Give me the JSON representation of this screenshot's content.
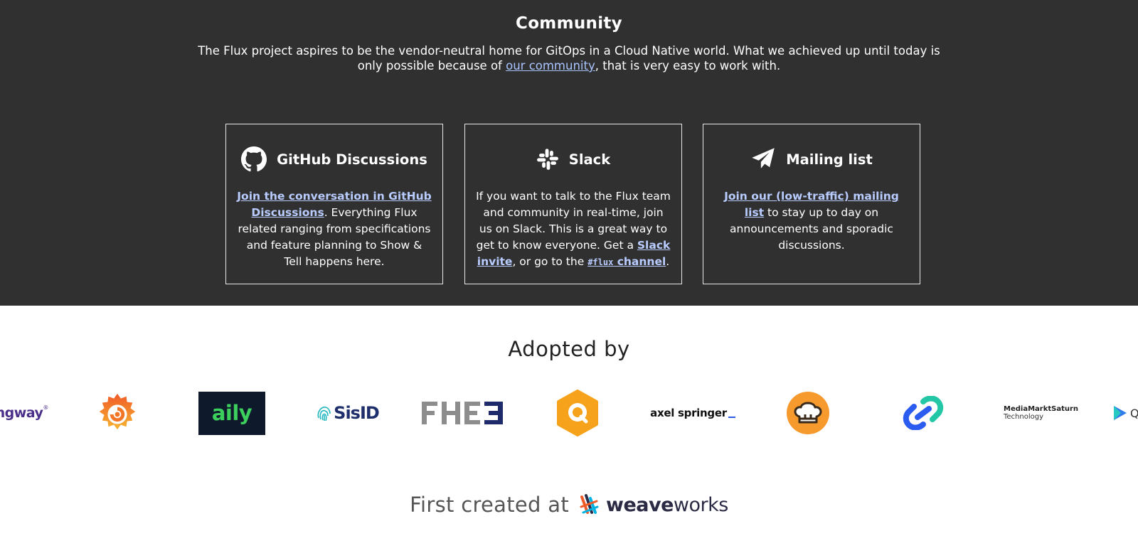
{
  "community": {
    "title": "Community",
    "intro_before": "The Flux project aspires to be the vendor-neutral home for GitOps in a Cloud Native world. What we achieved up until today is only possible because of ",
    "intro_link": "our community",
    "intro_after": ", that is very easy to work with.",
    "cards": [
      {
        "title": "GitHub Discussions",
        "icon": "github-icon",
        "link1": "Join the conversation in GitHub Discussions",
        "text1": ". Everything Flux related ranging from specifications and feature planning to Show & Tell happens here."
      },
      {
        "title": "Slack",
        "icon": "slack-icon",
        "text1": "If you want to talk to the Flux team and community in real-time, join us on Slack. This is a great way to get to know everyone. Get a ",
        "link1": "Slack invite",
        "text2": ", or go to the ",
        "link2_code": "#flux",
        "link2_text": " channel",
        "text3": "."
      },
      {
        "title": "Mailing list",
        "icon": "paper-plane-icon",
        "link1": "Join our (low-traffic) mailing list",
        "text1": " to stay up to day on announcements and sporadic discussions."
      }
    ]
  },
  "adopted": {
    "title": "Adopted by",
    "logos": [
      {
        "name": "gway-logo",
        "text": "ngway"
      },
      {
        "name": "grafana-logo",
        "text": ""
      },
      {
        "name": "aily-logo",
        "text": "aily"
      },
      {
        "name": "sisid-logo",
        "text": "SisID"
      },
      {
        "name": "fhe3-logo",
        "text": "FHE3"
      },
      {
        "name": "orange-hex-logo",
        "text": ""
      },
      {
        "name": "axel-springer-logo",
        "text": "axel springer"
      },
      {
        "name": "chef-logo",
        "text": ""
      },
      {
        "name": "link-logo",
        "text": ""
      },
      {
        "name": "mediamarktsaturn-logo",
        "text": "MediaMarktSaturn",
        "sub": "Technology"
      },
      {
        "name": "q-logo",
        "text": "Q"
      }
    ]
  },
  "footer": {
    "first_created": "First created at",
    "weave": "weave",
    "works": "works"
  },
  "colors": {
    "dark_bg": "#303030",
    "link": "#a9c5ff",
    "weaveworks_navy": "#2a2a44"
  }
}
